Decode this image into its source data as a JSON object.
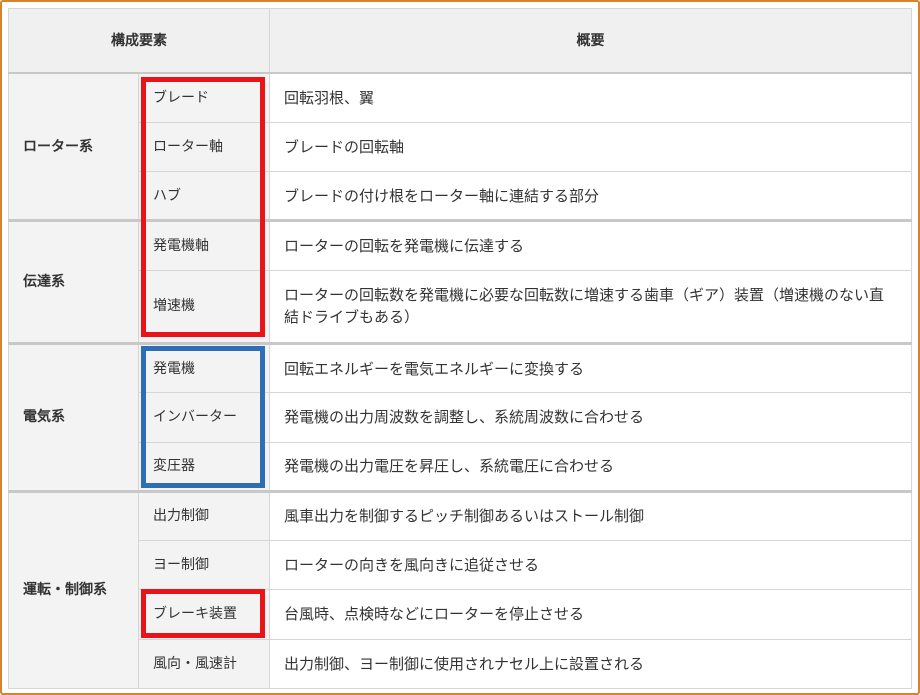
{
  "header": {
    "col_component": "構成要素",
    "col_summary": "概要"
  },
  "groups": [
    {
      "name": "ローター系",
      "rows": [
        {
          "element": "ブレード",
          "summary": "回転羽根、翼"
        },
        {
          "element": "ローター軸",
          "summary": "ブレードの回転軸"
        },
        {
          "element": "ハブ",
          "summary": "ブレードの付け根をローター軸に連結する部分"
        }
      ]
    },
    {
      "name": "伝達系",
      "rows": [
        {
          "element": "発電機軸",
          "summary": "ローターの回転を発電機に伝達する"
        },
        {
          "element": "増速機",
          "summary": "ローターの回転数を発電機に必要な回転数に増速する歯車（ギア）装置（増速機のない直結ドライブもある）"
        }
      ]
    },
    {
      "name": "電気系",
      "rows": [
        {
          "element": "発電機",
          "summary": "回転エネルギーを電気エネルギーに変換する"
        },
        {
          "element": "インバーター",
          "summary": "発電機の出力周波数を調整し、系統周波数に合わせる"
        },
        {
          "element": "変圧器",
          "summary": "発電機の出力電圧を昇圧し、系統電圧に合わせる"
        }
      ]
    },
    {
      "name": "運転・制御系",
      "rows": [
        {
          "element": "出力制御",
          "summary": "風車出力を制御するピッチ制御あるいはストール制御"
        },
        {
          "element": "ヨー制御",
          "summary": "ローターの向きを風向きに追従させる"
        },
        {
          "element": "ブレーキ装置",
          "summary": "台風時、点検時などにローターを停止させる"
        },
        {
          "element": "風向・風速計",
          "summary": "出力制御、ヨー制御に使用されナセル上に設置される"
        }
      ]
    }
  ],
  "highlights": {
    "red": "#e8141a",
    "blue": "#2e6eb5"
  }
}
